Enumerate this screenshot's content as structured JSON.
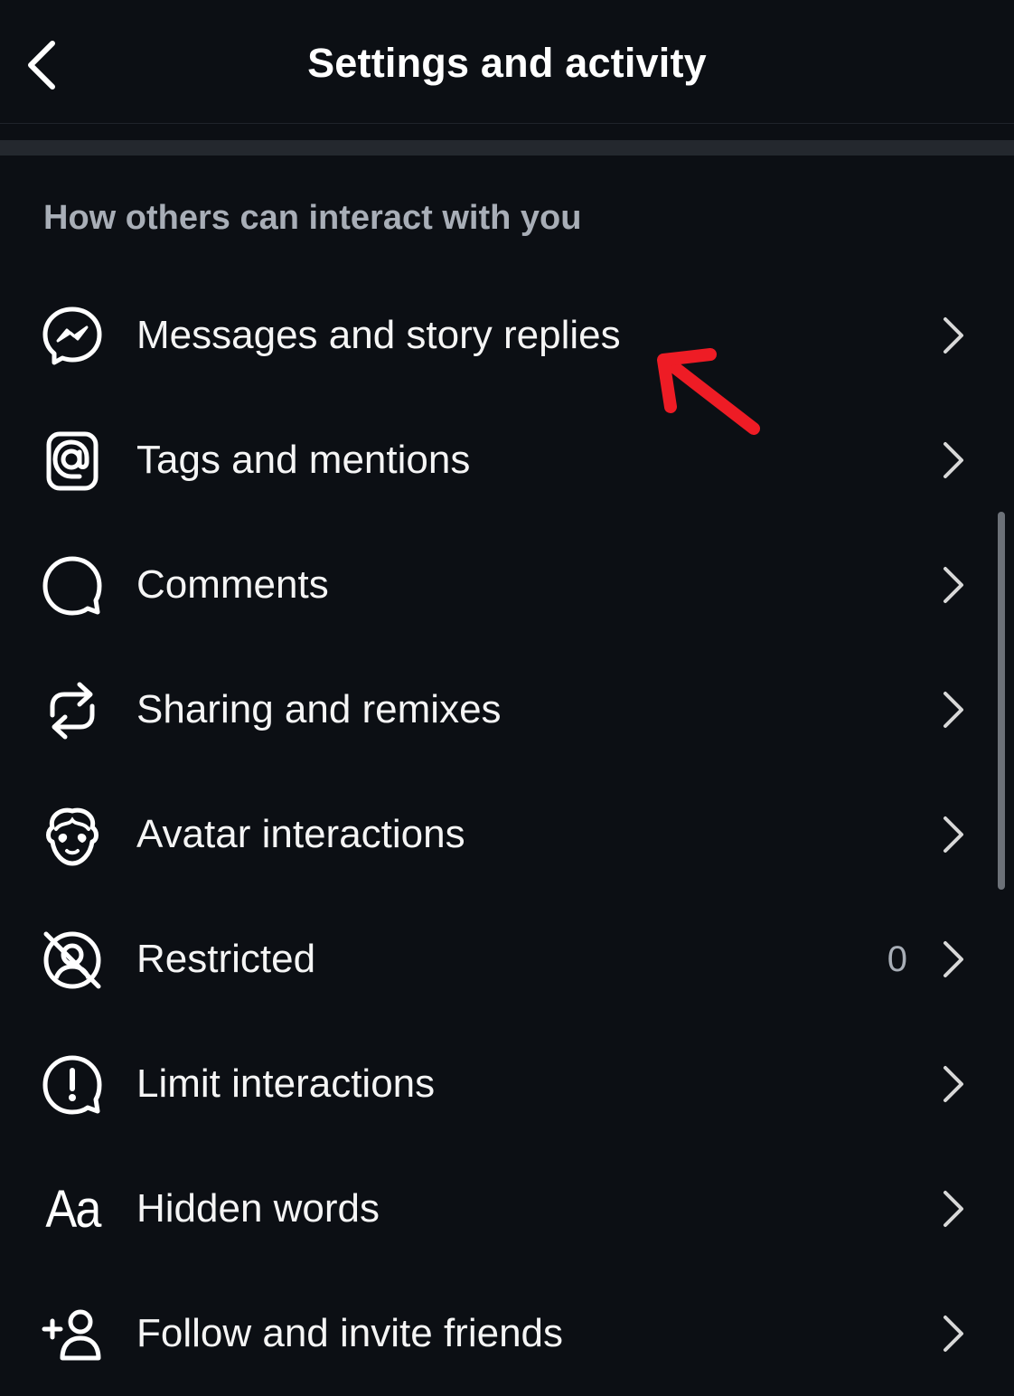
{
  "header": {
    "title": "Settings and activity",
    "back_icon": "chevron-left-icon"
  },
  "section": {
    "heading": "How others can interact with you"
  },
  "menu": {
    "items": [
      {
        "label": "Messages and story replies",
        "icon": "messenger-icon"
      },
      {
        "label": "Tags and mentions",
        "icon": "at-sign-icon"
      },
      {
        "label": "Comments",
        "icon": "comment-bubble-icon"
      },
      {
        "label": "Sharing and remixes",
        "icon": "share-remix-icon"
      },
      {
        "label": "Avatar interactions",
        "icon": "avatar-icon"
      },
      {
        "label": "Restricted",
        "icon": "restricted-icon",
        "count": "0"
      },
      {
        "label": "Limit interactions",
        "icon": "alert-bubble-icon"
      },
      {
        "label": "Hidden words",
        "icon": "aa-text-icon",
        "icon_text": "Aa"
      },
      {
        "label": "Follow and invite friends",
        "icon": "add-person-icon"
      }
    ],
    "chevron_icon": "chevron-right-icon"
  },
  "annotation": {
    "icon": "red-arrow-icon",
    "color": "#ee1c25"
  },
  "colors": {
    "background": "#0c0f14",
    "text": "#f5f5f5",
    "secondary_text": "#a8aeb7",
    "divider": "#24282e"
  }
}
